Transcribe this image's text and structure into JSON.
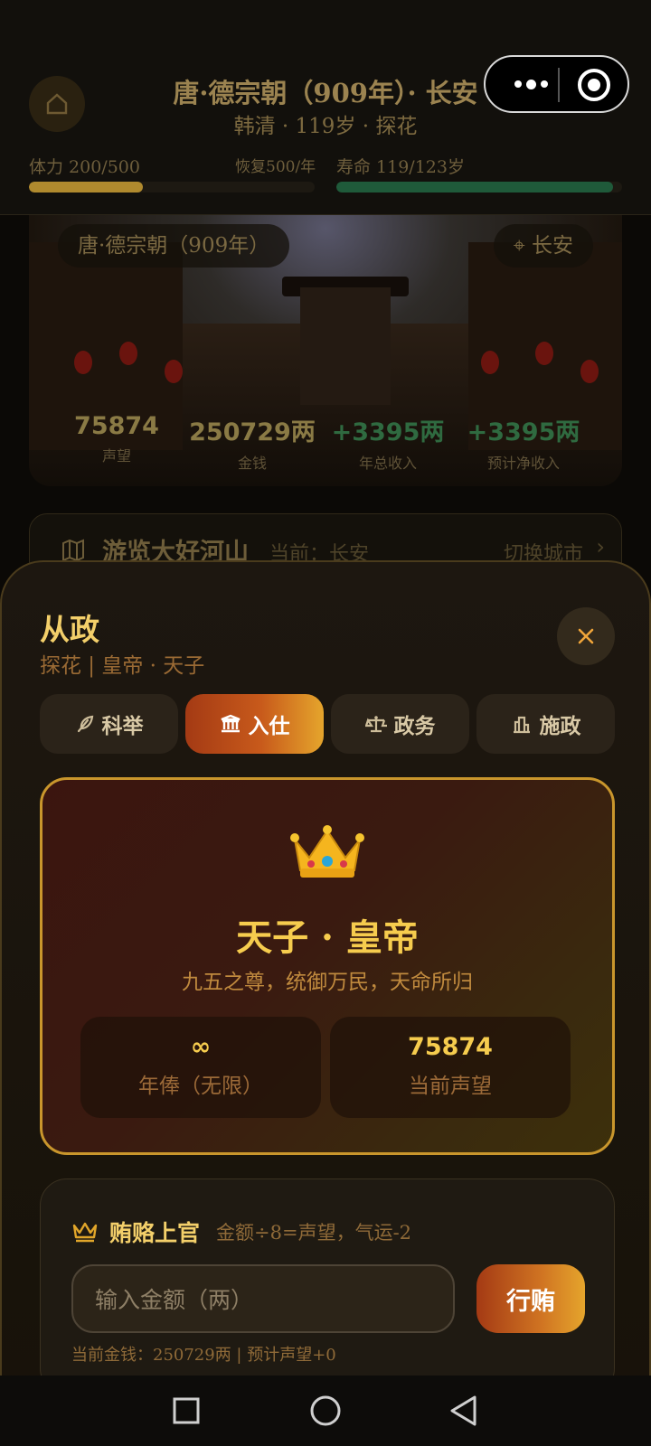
{
  "header": {
    "title": "唐·德宗朝（909年）· 长安",
    "subtitle": "韩清 · 119岁 · 探花",
    "stamina_label": "体力 200/500",
    "recovery_label": "恢复500/年",
    "lifespan_label": "寿命 119/123岁",
    "stamina_fraction": 0.4,
    "lifespan_fraction": 0.967,
    "stamina_color": "#b08a2e",
    "lifespan_color": "#1f5a3a"
  },
  "scene": {
    "era_label": "唐·德宗朝（909年）",
    "city_label": "长安",
    "stats": [
      {
        "value": "75874",
        "label": "声望",
        "color": "#8a7a45"
      },
      {
        "value": "250729两",
        "label": "金钱",
        "color": "#8a7a45"
      },
      {
        "value": "+3395两",
        "label": "年总收入",
        "color": "#2f6a40"
      },
      {
        "value": "+3395两",
        "label": "预计净收入",
        "color": "#2f6a40"
      }
    ]
  },
  "travel": {
    "title": "游览大好河山",
    "current": "当前：长安",
    "switch_label": "切换城市"
  },
  "panel": {
    "title": "从政",
    "subtitle": "探花 | 皇帝 · 天子",
    "tabs": [
      {
        "label": "科举",
        "icon": "feather-icon",
        "active": false
      },
      {
        "label": "入仕",
        "icon": "building-icon",
        "active": true
      },
      {
        "label": "政务",
        "icon": "scale-icon",
        "active": false
      },
      {
        "label": "施政",
        "icon": "landmark-icon",
        "active": false
      }
    ],
    "rank": {
      "icon": "crown-icon",
      "title": "天子 · 皇帝",
      "description": "九五之尊，统御万民，天命所归",
      "salary_value": "∞",
      "salary_label": "年俸（无限）",
      "reputation_value": "75874",
      "reputation_label": "当前声望"
    },
    "bribe": {
      "title": "贿赂上官",
      "description": "金额÷8=声望，气运-2",
      "input_placeholder": "输入金额（两）",
      "button_label": "行贿",
      "footer": "当前金钱：250729两 | 预计声望+0"
    }
  },
  "colors": {
    "accent_gold": "#f3cf6a",
    "active_tab_start": "#a43a14",
    "active_tab_end": "#e5a52c",
    "card_border": "#c9962c"
  }
}
